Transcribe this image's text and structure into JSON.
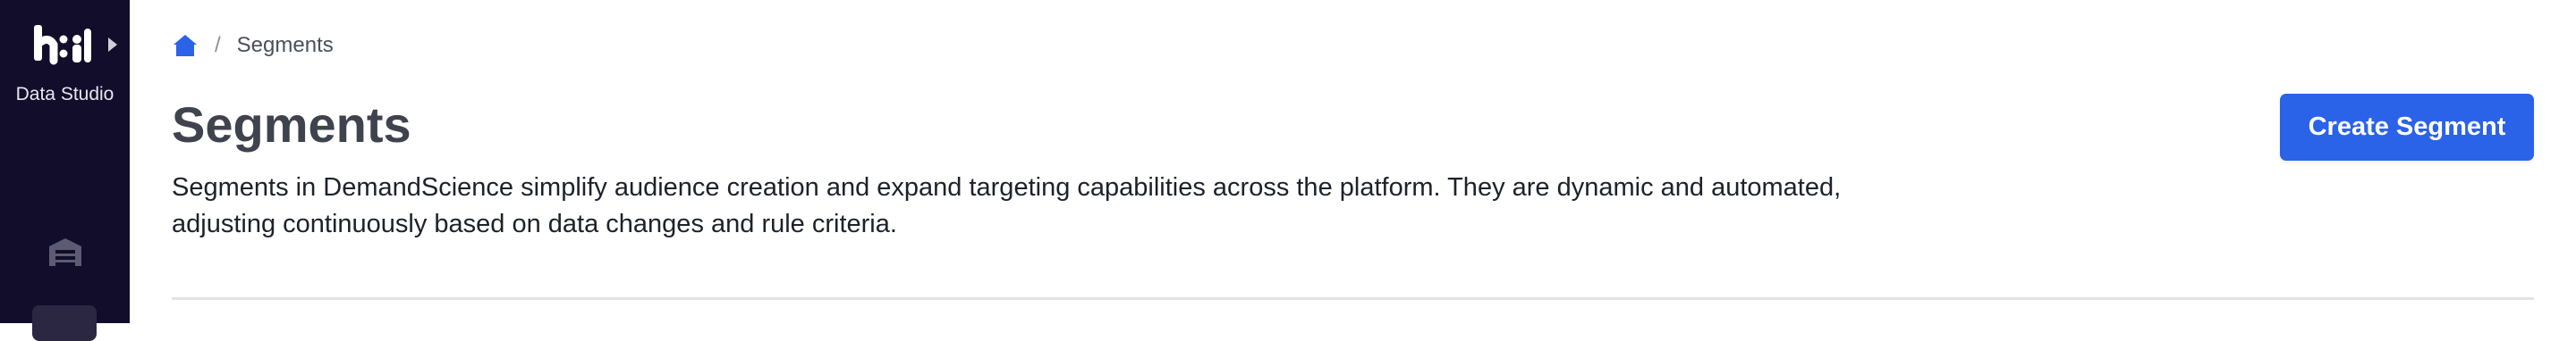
{
  "sidebar": {
    "app_label": "Data Studio",
    "logo_text": "h:i",
    "icons": [
      "warehouse-icon"
    ]
  },
  "breadcrumb": {
    "home_icon": "home-icon",
    "separator": "/",
    "current": "Segments"
  },
  "header": {
    "title": "Segments",
    "description": "Segments in DemandScience simplify audience creation and expand targeting capabilities across the platform. They are dynamic and automated, adjusting continuously based on data changes and rule criteria.",
    "create_button_label": "Create Segment"
  },
  "colors": {
    "sidebar_bg": "#120d2b",
    "primary": "#2a62e8",
    "title": "#3f434e"
  }
}
